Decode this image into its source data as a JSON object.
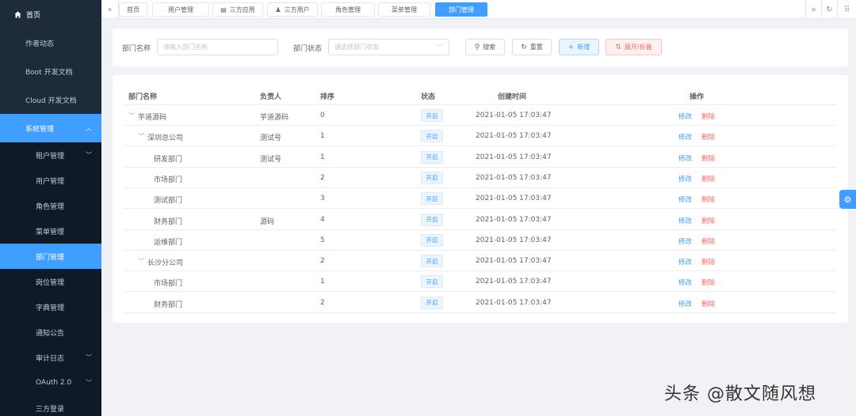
{
  "sidebar": {
    "home": "首页",
    "items_top": [
      "作者动态",
      "Boot 开发文档",
      "Cloud 开发文档"
    ],
    "system_group": "系统管理",
    "sub_items": [
      {
        "label": "租户管理",
        "chev": true
      },
      {
        "label": "用户管理"
      },
      {
        "label": "角色管理"
      },
      {
        "label": "菜单管理"
      },
      {
        "label": "部门管理",
        "active": true
      },
      {
        "label": "岗位管理"
      },
      {
        "label": "字典管理"
      },
      {
        "label": "通知公告"
      },
      {
        "label": "审计日志",
        "chev": true
      },
      {
        "label": "OAuth 2.0",
        "chev": true
      },
      {
        "label": "三方登录"
      }
    ],
    "colors": {
      "bg": "#1d2b3a",
      "sub_bg": "#101a27",
      "active": "#409eff"
    }
  },
  "tagsbar": {
    "tabs": [
      {
        "label": "首页"
      },
      {
        "label": "用户管理"
      },
      {
        "label": "三方应用",
        "icon": "app-icon"
      },
      {
        "label": "三方用户",
        "icon": "user-icon"
      },
      {
        "label": "角色管理"
      },
      {
        "label": "菜单管理"
      },
      {
        "label": "部门管理",
        "active": true
      }
    ]
  },
  "search": {
    "name_label": "部门名称",
    "name_placeholder": "请输入部门名称",
    "status_label": "部门状态",
    "status_placeholder": "请选择部门状态",
    "search_btn": "搜索",
    "reset_btn": "重置",
    "add_btn": "新增",
    "expand_btn": "展开/折叠"
  },
  "table": {
    "headers": [
      "部门名称",
      "负责人",
      "排序",
      "状态",
      "创建时间",
      "操作"
    ],
    "rows": [
      {
        "name": "芋道源码",
        "level": 0,
        "expand": true,
        "leader": "芋道源码",
        "sort": "0",
        "status": "开启",
        "created": "2021-01-05 17:03:47"
      },
      {
        "name": "深圳总公司",
        "level": 1,
        "expand": true,
        "leader": "测试号",
        "sort": "1",
        "status": "开启",
        "created": "2021-01-05 17:03:47"
      },
      {
        "name": "研发部门",
        "level": 2,
        "leader": "测试号",
        "sort": "1",
        "status": "开启",
        "created": "2021-01-05 17:03:47"
      },
      {
        "name": "市场部门",
        "level": 2,
        "leader": "",
        "sort": "2",
        "status": "开启",
        "created": "2021-01-05 17:03:47"
      },
      {
        "name": "测试部门",
        "level": 2,
        "leader": "",
        "sort": "3",
        "status": "开启",
        "created": "2021-01-05 17:03:47"
      },
      {
        "name": "财务部门",
        "level": 2,
        "leader": "源码",
        "sort": "4",
        "status": "开启",
        "created": "2021-01-05 17:03:47"
      },
      {
        "name": "运维部门",
        "level": 2,
        "leader": "",
        "sort": "5",
        "status": "开启",
        "created": "2021-01-05 17:03:47"
      },
      {
        "name": "长沙分公司",
        "level": 1,
        "expand": true,
        "leader": "",
        "sort": "2",
        "status": "开启",
        "created": "2021-01-05 17:03:47"
      },
      {
        "name": "市场部门",
        "level": 2,
        "leader": "",
        "sort": "1",
        "status": "开启",
        "created": "2021-01-05 17:03:47"
      },
      {
        "name": "财务部门",
        "level": 2,
        "leader": "",
        "sort": "2",
        "status": "开启",
        "created": "2021-01-05 17:03:47"
      }
    ],
    "edit_label": "修改",
    "delete_label": "删除"
  },
  "watermark": "头条 @散文随风想"
}
